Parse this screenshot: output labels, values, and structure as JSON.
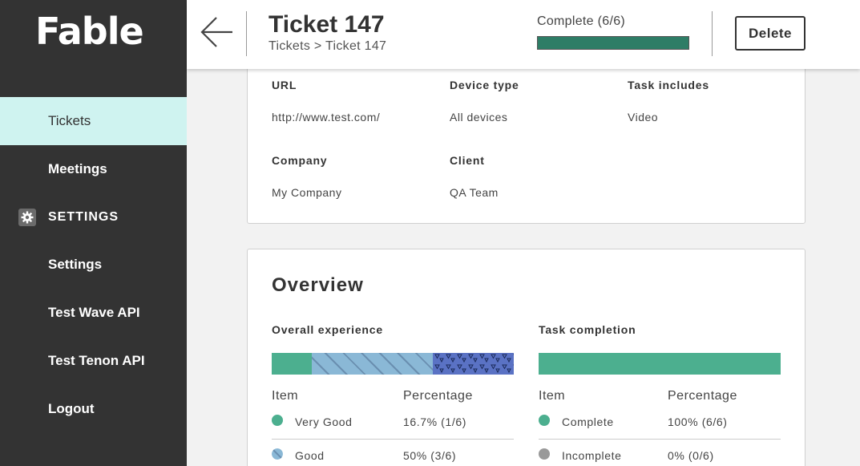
{
  "sidebar": {
    "logo": "Fable",
    "items": [
      {
        "label": "Tickets"
      },
      {
        "label": "Meetings"
      },
      {
        "label": "Settings"
      },
      {
        "label": "Test Wave API"
      },
      {
        "label": "Test Tenon API"
      },
      {
        "label": "Logout"
      }
    ],
    "section_label": "SETTINGS",
    "section_icon": "gear-icon"
  },
  "header": {
    "title": "Ticket 147",
    "breadcrumb": "Tickets > Ticket 147",
    "progress_label": "Complete (6/6)",
    "progress_fraction": 1.0,
    "delete_label": "Delete",
    "back_icon": "arrow-left-icon"
  },
  "details": {
    "url_label": "URL",
    "url_value": "http://www.test.com/",
    "device_label": "Device type",
    "device_value": "All devices",
    "includes_label": "Task includes",
    "includes_value": "Video",
    "company_label": "Company",
    "company_value": "My Company",
    "client_label": "Client",
    "client_value": "QA Team"
  },
  "overview": {
    "title": "Overview",
    "experience": {
      "title": "Overall experience",
      "col_item": "Item",
      "col_percentage": "Percentage",
      "segments": [
        {
          "fraction": 0.167,
          "color": "#4caf8f",
          "pattern": "solid"
        },
        {
          "fraction": 0.5,
          "color": "#8ab8d6",
          "pattern": "stripes"
        },
        {
          "fraction": 0.333,
          "color": "#5a72c4",
          "pattern": "triangles"
        }
      ],
      "rows": [
        {
          "label": "Very Good",
          "percentage": "16.7% (1/6)"
        },
        {
          "label": "Good",
          "percentage": "50% (3/6)"
        }
      ]
    },
    "completion": {
      "title": "Task completion",
      "col_item": "Item",
      "col_percentage": "Percentage",
      "segments": [
        {
          "fraction": 1.0,
          "color": "#4caf8f",
          "pattern": "solid"
        }
      ],
      "rows": [
        {
          "label": "Complete",
          "percentage": "100% (6/6)"
        },
        {
          "label": "Incomplete",
          "percentage": "0% (0/6)"
        }
      ]
    }
  },
  "colors": {
    "sidebar_bg": "#333333",
    "active_item_bg": "#cff3f0",
    "progress_fill": "#2e7d66",
    "very_good": "#4caf8f",
    "good": "#8ab8d6",
    "incomplete": "#999999"
  }
}
